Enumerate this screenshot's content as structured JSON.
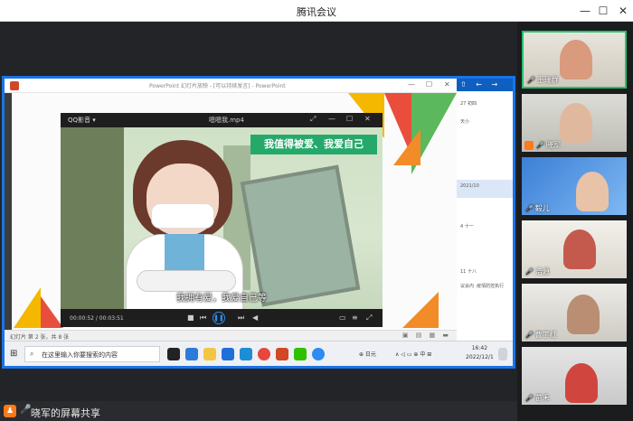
{
  "window": {
    "title": "腾讯会议",
    "min": "—",
    "max": "☐",
    "close": "✕"
  },
  "ppt": {
    "title": "PowerPoint 幻灯片放映 - [可以持续发言] - PowerPoint",
    "status": "幻灯片 第 2 张，共 8 张",
    "status_icons": "▣ ▤ ▦ ▬"
  },
  "player": {
    "brand": "QQ影音 ▾",
    "file": "嗯嗯我.mp4",
    "banner": "我值得被爱、我爱自己",
    "subtitle": "我拥有爱，我爱自己等",
    "time": "00:00:52 / 00:03:51",
    "progress": 0.23
  },
  "side_panel": {
    "head": "⇧ ← → ⌄",
    "rows": [
      "27 初四",
      "天小",
      "2021/10",
      "4 十一",
      "11 十八",
      "议会内 ·疫情防控执行"
    ]
  },
  "taskbar": {
    "start_icon": "⊞",
    "search_icon": "⌕",
    "search_placeholder": "在这里输入你要搜索的内容",
    "tray_text": "⊕ 日元",
    "tray_text2": "∧ ◁ ▭ ⊕ 中 ⊞",
    "time": "16:42",
    "date": "2022/12/1"
  },
  "bottombar": {
    "user_icon": "♟",
    "mic_icon": "🎤",
    "share_label": "晓军的屏幕共享"
  },
  "participants": [
    {
      "name": "王瑞群",
      "active": true
    },
    {
      "name": "晓军",
      "active": false
    },
    {
      "name": "毅儿",
      "active": false
    },
    {
      "name": "浩源",
      "active": false
    },
    {
      "name": "曹宇红",
      "active": false
    },
    {
      "name": "苗禾",
      "active": false
    }
  ],
  "colors": {
    "share_border": "#1a73e8",
    "active_speaker": "#25c16f",
    "banner_green": "#25a96b",
    "accent_orange": "#ff7a1a"
  }
}
